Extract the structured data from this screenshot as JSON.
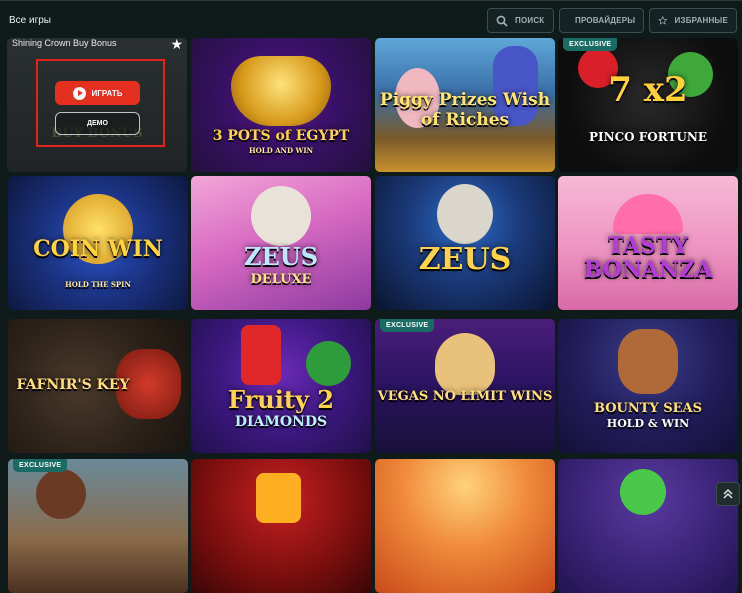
{
  "header": {
    "title": "Все игры",
    "search_label": "ПОИСК",
    "providers_label": "ПРОВАЙДЕРЫ",
    "favorites_label": "ИЗБРАННЫЕ"
  },
  "hover_card": {
    "title": "Shining Crown Buy Bonus",
    "play_label": "ИГРАТЬ",
    "demo_label": "ДЕМО",
    "bg_text": "BUY BONUS"
  },
  "games": [
    {
      "title": "3 POTS of EGYPT",
      "subtitle": "HOLD AND WIN",
      "badge": ""
    },
    {
      "title": "Piggy Prizes Wish of Riches",
      "subtitle": "",
      "badge": ""
    },
    {
      "title": "PINCO FORTUNE",
      "subtitle": "7 x2",
      "badge": "EXCLUSIVE"
    },
    {
      "title": "COIN WIN",
      "subtitle": "HOLD THE SPIN",
      "badge": ""
    },
    {
      "title": "ZEUS",
      "subtitle": "DELUXE",
      "badge": ""
    },
    {
      "title": "ZEUS",
      "subtitle": "",
      "badge": ""
    },
    {
      "title": "TASTY BONANZA",
      "subtitle": "",
      "badge": ""
    },
    {
      "title": "FAFNIR'S KEY",
      "subtitle": "",
      "badge": ""
    },
    {
      "title": "Fruity 2",
      "subtitle": "DIAMONDS",
      "badge": ""
    },
    {
      "title": "VEGAS NO LIMIT WINS",
      "subtitle": "",
      "badge": "EXCLUSIVE"
    },
    {
      "title": "BOUNTY SEAS",
      "subtitle": "HOLD & WIN",
      "badge": ""
    },
    {
      "title": "",
      "subtitle": "",
      "badge": "EXCLUSIVE"
    },
    {
      "title": "",
      "subtitle": "",
      "badge": ""
    },
    {
      "title": "",
      "subtitle": "",
      "badge": ""
    },
    {
      "title": "",
      "subtitle": "",
      "badge": ""
    }
  ],
  "colors": {
    "background": "#0f1a1b",
    "accent_red": "#e5301f",
    "exclusive_badge": "#1a6b63"
  }
}
